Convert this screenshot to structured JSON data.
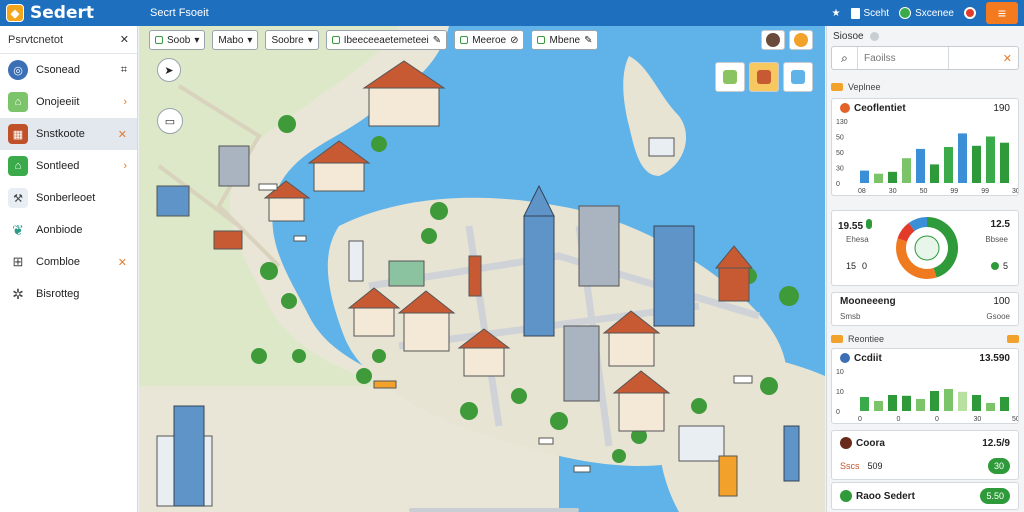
{
  "app": {
    "title": "Sedert",
    "tab": "Secrt Fsoeit"
  },
  "topbar": {
    "items": [
      {
        "label": "",
        "icon": "star-icon"
      },
      {
        "label": "Sceht",
        "icon": "card-icon"
      },
      {
        "label": "Sxcenee",
        "icon": "globe-icon"
      },
      {
        "label": "",
        "icon": "person-icon"
      }
    ],
    "accent": "#f47a20"
  },
  "sidebar": {
    "title": "Psrvtcnetot",
    "items": [
      {
        "label": "Csonead",
        "icon": "globe-icon",
        "trail": "binoculars",
        "active": false
      },
      {
        "label": "Onojeeiit",
        "icon": "house-icon",
        "trail": ">",
        "active": false
      },
      {
        "label": "Snstkoote",
        "icon": "building-icon",
        "trail": "x",
        "active": true
      },
      {
        "label": "Sontleed",
        "icon": "cabin-icon",
        "trail": ">",
        "active": false
      },
      {
        "label": "Sonberleoet",
        "icon": "tools-icon",
        "trail": "",
        "active": false
      },
      {
        "label": "Aonbiode",
        "icon": "leaf-icon",
        "trail": "",
        "active": false
      },
      {
        "label": "Combloe",
        "icon": "gamepad-icon",
        "trail": "x",
        "active": false
      },
      {
        "label": "Bisrotteg",
        "icon": "gear-icon",
        "trail": "",
        "active": false
      }
    ]
  },
  "toolbar": {
    "buttons": [
      {
        "label": "Soob",
        "icon": "check-icon"
      },
      {
        "label": "Mabo",
        "icon": "dropdown-icon"
      },
      {
        "label": "Soobre",
        "icon": "dropdown-icon"
      },
      {
        "label": "Ibeeceeaetemeteei",
        "icon": "edit-icon"
      },
      {
        "label": "Meeroe",
        "icon": "toggle-icon"
      },
      {
        "label": "Mbene",
        "icon": "edit-icon"
      }
    ]
  },
  "right_panel": {
    "title": "Siosoe",
    "search_placeholder": "Faoilss",
    "section1": "Veplnee",
    "card1": {
      "title": "Ceoflentiet",
      "value": "190",
      "yticks": [
        "130",
        "50",
        "50",
        "30",
        "0"
      ],
      "xticks": [
        "08",
        "30",
        "50",
        "99",
        "99",
        "30"
      ],
      "bars": [
        {
          "value": 20,
          "color": "#3b8fd6"
        },
        {
          "value": 15,
          "color": "#7cc46a"
        },
        {
          "value": 18,
          "color": "#2e9a3a"
        },
        {
          "value": 40,
          "color": "#7cc46a"
        },
        {
          "value": 55,
          "color": "#3b8fd6"
        },
        {
          "value": 30,
          "color": "#2e9a3a"
        },
        {
          "value": 58,
          "color": "#3aaa4a"
        },
        {
          "value": 80,
          "color": "#3b8fd6"
        },
        {
          "value": 60,
          "color": "#2e9a3a"
        },
        {
          "value": 75,
          "color": "#3aaa4a"
        },
        {
          "value": 65,
          "color": "#2e9a3a"
        }
      ]
    },
    "card2": {
      "left_value": "19.55",
      "left_sub": "Ehesa",
      "left2": "15",
      "left2b": "0",
      "right_value": "12.5",
      "right_sub": "Bbsee",
      "right2": "5",
      "donut": [
        {
          "value": 45,
          "color": "#2e9a3a"
        },
        {
          "value": 35,
          "color": "#f07a20"
        },
        {
          "value": 10,
          "color": "#e23b2a"
        },
        {
          "value": 10,
          "color": "#3b8fd6"
        }
      ]
    },
    "card3": {
      "title": "Mooneeeng",
      "right": "100",
      "sub": "Smsb",
      "sub2": "Gsooe"
    },
    "section2": "Reontiee",
    "card4": {
      "title": "Ccdiit",
      "value": "13.590",
      "yticks": [
        "10",
        "10",
        "0"
      ],
      "xticks": [
        "0",
        "0",
        "0",
        "30",
        "50"
      ],
      "bars": [
        {
          "value": 35,
          "color": "#3aaa4a"
        },
        {
          "value": 25,
          "color": "#7cc46a"
        },
        {
          "value": 40,
          "color": "#2e9a3a"
        },
        {
          "value": 38,
          "color": "#2e9a3a"
        },
        {
          "value": 30,
          "color": "#7cc46a"
        },
        {
          "value": 50,
          "color": "#2e9a3a"
        },
        {
          "value": 55,
          "color": "#7cc46a"
        },
        {
          "value": 48,
          "color": "#b8e0a0"
        },
        {
          "value": 40,
          "color": "#2e9a3a"
        },
        {
          "value": 20,
          "color": "#7cc46a"
        },
        {
          "value": 35,
          "color": "#2e9a3a"
        }
      ]
    },
    "card5": {
      "title": "Coora",
      "value": "12.5/9",
      "row2a": "Sscs",
      "row2b": "509",
      "row2c": "30"
    },
    "card6": {
      "title": "Raoo Sedert",
      "pill": "5.50"
    }
  }
}
